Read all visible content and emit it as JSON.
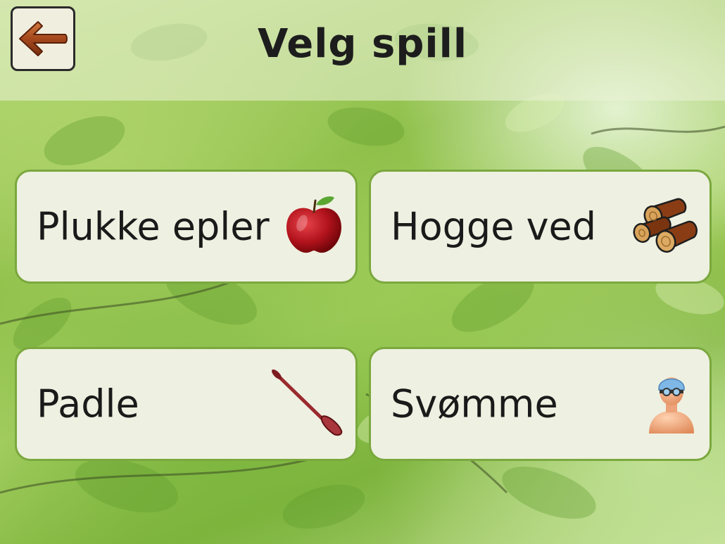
{
  "header": {
    "title": "Velg spill",
    "back_icon": "back-arrow-icon"
  },
  "games": [
    {
      "label": "Plukke epler",
      "icon": "apple-icon"
    },
    {
      "label": "Hogge ved",
      "icon": "firewood-logs-icon"
    },
    {
      "label": "Padle",
      "icon": "paddle-icon"
    },
    {
      "label": "Svømme",
      "icon": "swimmer-icon"
    }
  ],
  "colors": {
    "tile_background": "#eef0e1",
    "tile_border": "#7aa83e",
    "title_text": "#1d1d1d",
    "back_arrow": "#a4481c"
  }
}
